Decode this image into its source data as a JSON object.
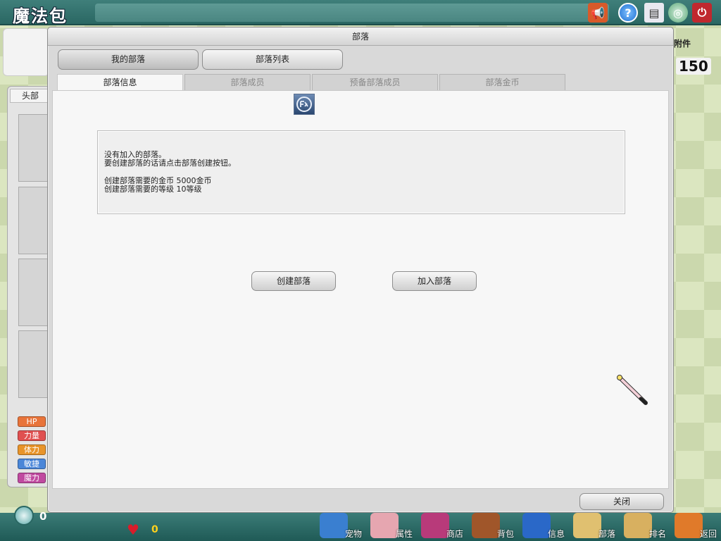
{
  "app": {
    "title": "魔法包"
  },
  "top_icons": [
    "megaphone-icon",
    "help-icon",
    "book-icon",
    "coin-stack-icon",
    "power-icon"
  ],
  "background": {
    "right_label": "附件",
    "right_number": "150",
    "left_tab": "头部",
    "stats": [
      "HP",
      "力量",
      "体力",
      "敏捷",
      "魔力"
    ],
    "coins": "0",
    "hearts": "0"
  },
  "nav": [
    {
      "label": "宠物",
      "icon": "pet-icon"
    },
    {
      "label": "属性",
      "icon": "attribute-icon"
    },
    {
      "label": "商店",
      "icon": "shop-icon"
    },
    {
      "label": "背包",
      "icon": "backpack-icon"
    },
    {
      "label": "信息",
      "icon": "info-icon"
    },
    {
      "label": "部落",
      "icon": "tribe-icon"
    },
    {
      "label": "排名",
      "icon": "ranking-icon"
    },
    {
      "label": "返回",
      "icon": "return-icon"
    }
  ],
  "dialog": {
    "title": "部落",
    "top_buttons": [
      "我的部落",
      "部落列表"
    ],
    "tabs": [
      "部落信息",
      "部落成员",
      "预备部落成员",
      "部落金币"
    ],
    "info": {
      "line1": "没有加入的部落。",
      "line2": "要创建部落的话请点击部落创建按钮。",
      "line3": "创建部落需要的金币 5000金币",
      "line4": "创建部落需要的等级 10等级"
    },
    "create_button": "创建部落",
    "join_button": "加入部落",
    "close_button": "关闭"
  },
  "colors": {
    "topbar": "#2a6763",
    "hp": "#e8743a",
    "strength": "#e05050",
    "stamina": "#e8942a",
    "agility": "#4a86d8",
    "magic": "#c04aa0"
  }
}
